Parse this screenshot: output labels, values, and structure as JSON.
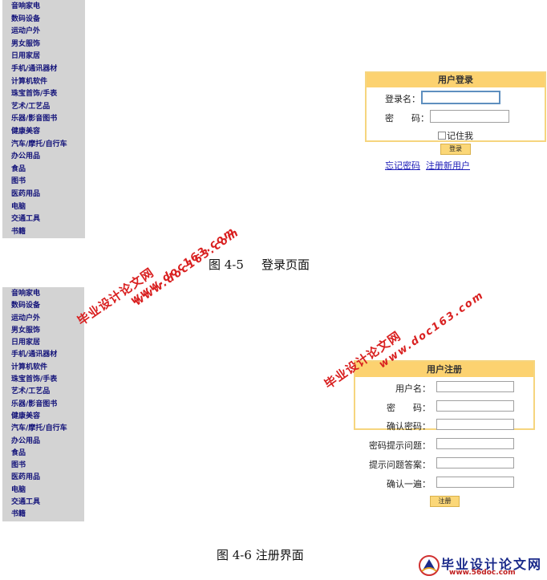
{
  "categories": [
    "音响家电",
    "数码设备",
    "运动户外",
    "男女服饰",
    "日用家居",
    "手机/通讯器材",
    "计算机软件",
    "珠宝首饰/手表",
    "艺术/工艺品",
    "乐器/影音图书",
    "健康美容",
    "汽车/摩托/自行车",
    "办公用品",
    "食品",
    "图书",
    "医药用品",
    "电脑",
    "交通工具",
    "书籍"
  ],
  "captions": {
    "top_number": "图 4-5",
    "top_title": "登录页面",
    "bottom": "图 4-6 注册界面"
  },
  "login": {
    "header": "用户登录",
    "name_label": "登录名：",
    "password_label": "密　　码：",
    "remember_label": "记住我",
    "submit_label": "登录",
    "forgot_link": "忘记密码",
    "register_link": "注册新用户"
  },
  "register": {
    "header": "用户注册",
    "fields": [
      "用户名：",
      "密　　码：",
      "确认密码：",
      "密码提示问题：",
      "提示问题答案：",
      "确认一遍："
    ],
    "submit_label": "注册"
  },
  "watermarks": {
    "cn": "毕业设计论文网",
    "url": "www.doc163.com"
  },
  "logo": {
    "cn": "毕业设计论文网",
    "url": "www.56doc.com"
  }
}
